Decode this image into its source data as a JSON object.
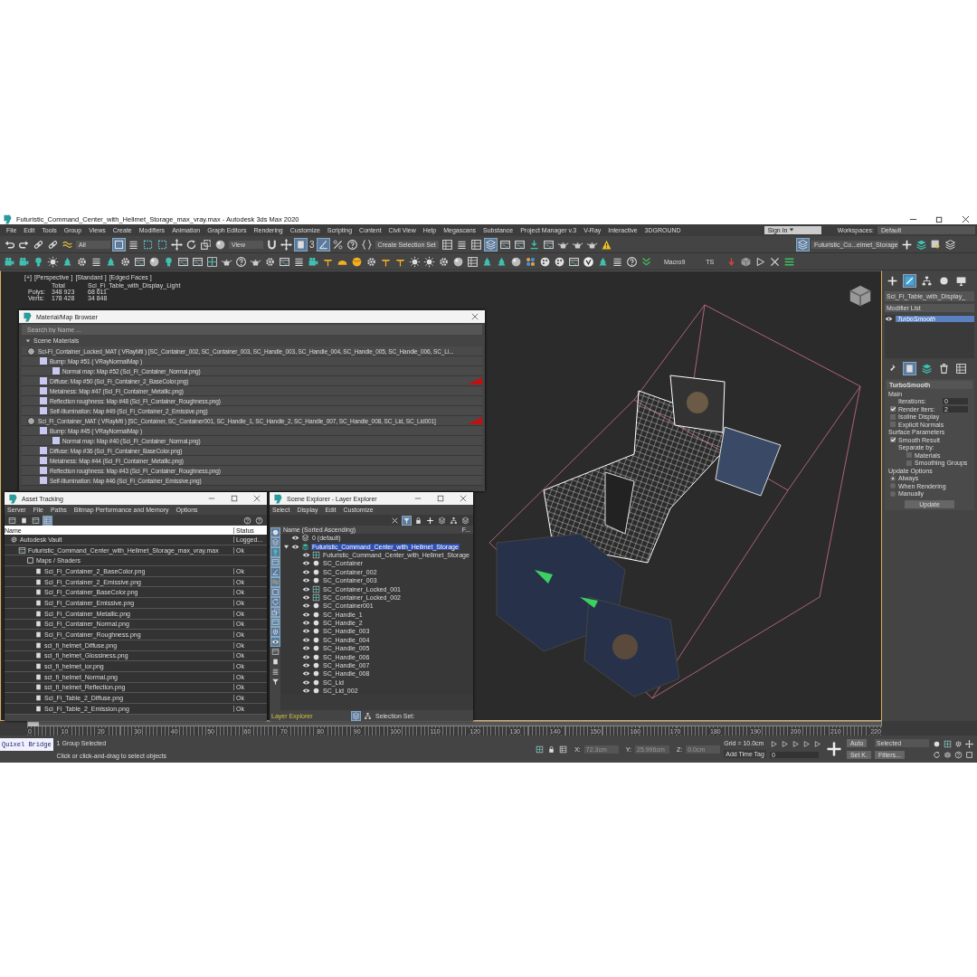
{
  "window": {
    "title": "Futuristic_Command_Center_with_Hellmet_Storage_max_vray.max - Autodesk 3ds Max 2020"
  },
  "menu": [
    "File",
    "Edit",
    "Tools",
    "Group",
    "Views",
    "Create",
    "Modifiers",
    "Animation",
    "Graph Editors",
    "Rendering",
    "Customize",
    "Scripting",
    "Content",
    "Civil View",
    "Help",
    "Megascans",
    "Substance",
    "Project Manager v.3",
    "V-Ray",
    "Interactive",
    "3DGROUND"
  ],
  "account": {
    "sign_in": "Sign In",
    "workspaces_label": "Workspaces:",
    "workspace": "Default"
  },
  "toolbar": {
    "filter": "All",
    "reference": "View",
    "snap_digit": "3",
    "selection_set": "Create Selection Set",
    "layer": "Futuristic_Co...elmet_Storage",
    "macro_1": "Macro9",
    "macro_2": "TS"
  },
  "viewport": {
    "labels": [
      "[+]",
      "[Perspective ]",
      "[Standard ]",
      "[Edged Faces ]"
    ],
    "stats": {
      "columns": [
        "Total",
        "Sci_Fi_Table_with_Display_Light"
      ],
      "rows": [
        {
          "label": "Polys:",
          "values": [
            "348 923",
            "68 611"
          ]
        },
        {
          "label": "Verts:",
          "values": [
            "178 428",
            "34 848"
          ]
        }
      ]
    }
  },
  "material_browser": {
    "title": "Material/Map Browser",
    "search_placeholder": "Search by Name ...",
    "section": "Scene Materials",
    "rows": [
      {
        "kind": "material",
        "text": "Sci-Fi_Container_Locked_MAT  ( VRayMtl )  [SC_Container_002, SC_Container_003, SC_Handle_003, SC_Handle_004, SC_Handle_005, SC_Handle_006, SC_Li...",
        "flagged": false,
        "children": [
          {
            "kind": "map",
            "text": "Bump: Map #51  ( VRayNormalMap )",
            "flagged": false,
            "children": [
              {
                "kind": "map",
                "text": "Normal map: Map #52 (Sci_Fi_Container_Normal.png)",
                "flagged": false
              }
            ]
          },
          {
            "kind": "map",
            "text": "Diffuse: Map #50 (Sci_Fi_Container_2_BaseColor.png)",
            "flagged": true
          },
          {
            "kind": "map",
            "text": "Metalness: Map #47 (Sci_Fi_Container_Metallic.png)",
            "flagged": false
          },
          {
            "kind": "map",
            "text": "Reflection roughness: Map #48 (Sci_Fi_Container_Roughness.png)",
            "flagged": false
          },
          {
            "kind": "map",
            "text": "Self-Illumination: Map #49 (Sci_Fi_Container_2_Emissive.png)",
            "flagged": false
          }
        ]
      },
      {
        "kind": "material",
        "text": "Sci_Fi_Container_MAT  ( VRayMtl )  [SC_Container, SC_Container001, SC_Handle_1, SC_Handle_2, SC_Handle_007, SC_Handle_008, SC_Lid, SC_Lid001]",
        "flagged": true,
        "children": [
          {
            "kind": "map",
            "text": "Bump: Map #45  ( VRayNormalMap )",
            "flagged": false,
            "children": [
              {
                "kind": "map",
                "text": "Normal map: Map #40 (Sci_Fi_Container_Normal.png)",
                "flagged": false
              }
            ]
          },
          {
            "kind": "map",
            "text": "Diffuse: Map #36 (Sci_Fi_Container_BaseColor.png)",
            "flagged": false
          },
          {
            "kind": "map",
            "text": "Metalness: Map #44 (Sci_Fi_Container_Metallic.png)",
            "flagged": false
          },
          {
            "kind": "map",
            "text": "Reflection roughness: Map #43 (Sci_Fi_Container_Roughness.png)",
            "flagged": false
          },
          {
            "kind": "map",
            "text": "Self-Illumination: Map #46 (Sci_Fi_Container_Emissive.png)",
            "flagged": false
          }
        ]
      }
    ]
  },
  "asset_tracking": {
    "title": "Asset Tracking",
    "menu": [
      "Server",
      "File",
      "Paths",
      "Bitmap Performance and Memory",
      "Options"
    ],
    "columns": [
      "Name",
      "Status"
    ],
    "rows": [
      {
        "kind": "vault",
        "name": "Autodesk Vault",
        "status": "Logged...",
        "children": [
          {
            "kind": "scene",
            "name": "Futuristic_Command_Center_with_Hellmet_Storage_max_vray.max",
            "status": "Ok",
            "children": [
              {
                "kind": "folder",
                "name": "Maps / Shaders",
                "children": [
                  {
                    "kind": "image",
                    "name": "Sci_Fi_Container_2_BaseColor.png",
                    "status": "Ok"
                  },
                  {
                    "kind": "image",
                    "name": "Sci_Fi_Container_2_Emissive.png",
                    "status": "Ok"
                  },
                  {
                    "kind": "image",
                    "name": "Sci_Fi_Container_BaseColor.png",
                    "status": "Ok"
                  },
                  {
                    "kind": "image",
                    "name": "Sci_Fi_Container_Emissive.png",
                    "status": "Ok"
                  },
                  {
                    "kind": "image",
                    "name": "Sci_Fi_Container_Metallic.png",
                    "status": "Ok"
                  },
                  {
                    "kind": "image",
                    "name": "Sci_Fi_Container_Normal.png",
                    "status": "Ok"
                  },
                  {
                    "kind": "image",
                    "name": "Sci_Fi_Container_Roughness.png",
                    "status": "Ok"
                  },
                  {
                    "kind": "image",
                    "name": "sci_fi_helmet_Diffuse.png",
                    "status": "Ok"
                  },
                  {
                    "kind": "image",
                    "name": "sci_fi_helmet_Glossiness.png",
                    "status": "Ok"
                  },
                  {
                    "kind": "image",
                    "name": "sci_fi_helmet_ior.png",
                    "status": "Ok"
                  },
                  {
                    "kind": "image",
                    "name": "sci_fi_helmet_Normal.png",
                    "status": "Ok"
                  },
                  {
                    "kind": "image",
                    "name": "sci_fi_helmet_Reflection.png",
                    "status": "Ok"
                  },
                  {
                    "kind": "image",
                    "name": "Sci_Fi_Table_2_Diffuse.png",
                    "status": "Ok"
                  },
                  {
                    "kind": "image",
                    "name": "Sci_Fi_Table_2_Emission.png",
                    "status": "Ok"
                  }
                ]
              }
            ]
          }
        ]
      }
    ]
  },
  "scene_explorer": {
    "title": "Scene Explorer - Layer Explorer",
    "menu": [
      "Select",
      "Display",
      "Edit",
      "Customize"
    ],
    "column": "Name (Sorted Ascending)",
    "column_2": "F...",
    "rows": [
      {
        "kind": "layer",
        "name": "0 (default)",
        "selected": false
      },
      {
        "kind": "active-layer",
        "name": "Futuristic_Command_Center_with_Hellmet_Storage",
        "selected": true,
        "expanded": true,
        "children": [
          {
            "kind": "group",
            "name": "Futuristic_Command_Center_with_Hellmet_Storage",
            "selected": false
          },
          {
            "kind": "object",
            "name": "SC_Container",
            "selected": false
          },
          {
            "kind": "object",
            "name": "SC_Container_002",
            "selected": false
          },
          {
            "kind": "object",
            "name": "SC_Container_003",
            "selected": false
          },
          {
            "kind": "group",
            "name": "SC_Container_Locked_001",
            "selected": false
          },
          {
            "kind": "group",
            "name": "SC_Container_Locked_002",
            "selected": false
          },
          {
            "kind": "object",
            "name": "SC_Container001",
            "selected": false
          },
          {
            "kind": "object",
            "name": "SC_Handle_1",
            "selected": false
          },
          {
            "kind": "object",
            "name": "SC_Handle_2",
            "selected": false
          },
          {
            "kind": "object",
            "name": "SC_Handle_003",
            "selected": false
          },
          {
            "kind": "object",
            "name": "SC_Handle_004",
            "selected": false
          },
          {
            "kind": "object",
            "name": "SC_Handle_005",
            "selected": false
          },
          {
            "kind": "object",
            "name": "SC_Handle_006",
            "selected": false
          },
          {
            "kind": "object",
            "name": "SC_Handle_007",
            "selected": false
          },
          {
            "kind": "object",
            "name": "SC_Handle_008",
            "selected": false
          },
          {
            "kind": "object",
            "name": "SC_Lid",
            "selected": false
          },
          {
            "kind": "object",
            "name": "SC_Lid_002",
            "selected": false
          }
        ]
      }
    ],
    "footer": {
      "explorer": "Layer Explorer",
      "selection_set": "Selection Set:"
    }
  },
  "command_panel": {
    "object_name": "Sci_Fi_Table_with_Display_",
    "modifier_list": "Modifier List",
    "stack": [
      {
        "name": "TurboSmooth",
        "selected": true
      }
    ],
    "rollout": {
      "title": "TurboSmooth",
      "main": "Main",
      "spinners": [
        {
          "label": "Iterations:",
          "value": "0",
          "kind": "spinner"
        },
        {
          "label": "Render Iters:",
          "value": "2",
          "checked": true,
          "kind": "check-spinner"
        }
      ],
      "checks": [
        {
          "label": "Isoline Display",
          "checked": false
        },
        {
          "label": "Explicit Normals",
          "checked": false
        }
      ],
      "surface": "Surface Parameters",
      "smooth": {
        "label": "Smooth Result",
        "checked": true
      },
      "separate": "Separate by:",
      "separate_checks": [
        {
          "label": "Materials",
          "checked": false
        },
        {
          "label": "Smoothing Groups",
          "checked": false
        }
      ],
      "update": "Update Options",
      "radios": [
        {
          "label": "Always",
          "selected": true
        },
        {
          "label": "When Rendering",
          "selected": false
        },
        {
          "label": "Manually",
          "selected": false
        }
      ],
      "button": "Update"
    }
  },
  "timeline": {
    "level": 0,
    "ticks": [
      "0",
      "10",
      "20",
      "30",
      "40",
      "50",
      "60",
      "70",
      "80",
      "90",
      "100",
      "110",
      "120",
      "130",
      "140",
      "150",
      "160",
      "170",
      "180",
      "190",
      "200",
      "210",
      "220"
    ]
  },
  "status_bar": {
    "script_listener": "Quixel Bridge",
    "selection": "1 Group Selected",
    "prompt": "Click or click-and-drag to select objects",
    "coordinates": [
      {
        "label": "X:",
        "value": "72.3cm"
      },
      {
        "label": "Y:",
        "value": "25.996cm"
      },
      {
        "label": "Z:",
        "value": "0.0cm"
      }
    ],
    "grid": "Grid = 10.0cm",
    "time_tag": "Add Time Tag",
    "auto": "Auto",
    "key_filter": "Selected",
    "set_key": "Set K.",
    "filters": "Filters...",
    "frame": "0"
  }
}
